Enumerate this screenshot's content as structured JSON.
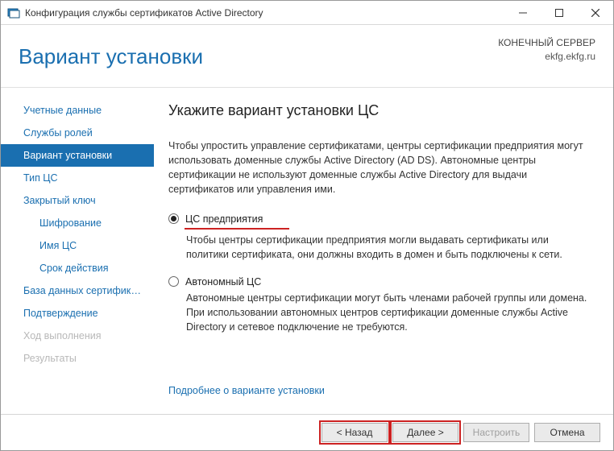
{
  "colors": {
    "accent": "#1a6fb0",
    "highlight": "#c22"
  },
  "titlebar": {
    "title": "Конфигурация службы сертификатов Active Directory"
  },
  "header": {
    "title": "Вариант установки",
    "meta_label": "КОНЕЧНЫЙ СЕРВЕР",
    "meta_value": "ekfg.ekfg.ru"
  },
  "sidebar": {
    "items": [
      {
        "label": "Учетные данные",
        "active": false,
        "disabled": false,
        "level": 1
      },
      {
        "label": "Службы ролей",
        "active": false,
        "disabled": false,
        "level": 1
      },
      {
        "label": "Вариант установки",
        "active": true,
        "disabled": false,
        "level": 1
      },
      {
        "label": "Тип ЦС",
        "active": false,
        "disabled": false,
        "level": 1
      },
      {
        "label": "Закрытый ключ",
        "active": false,
        "disabled": false,
        "level": 1
      },
      {
        "label": "Шифрование",
        "active": false,
        "disabled": false,
        "level": 2
      },
      {
        "label": "Имя ЦС",
        "active": false,
        "disabled": false,
        "level": 2
      },
      {
        "label": "Срок действия",
        "active": false,
        "disabled": false,
        "level": 2
      },
      {
        "label": "База данных сертификат...",
        "active": false,
        "disabled": false,
        "level": 1
      },
      {
        "label": "Подтверждение",
        "active": false,
        "disabled": false,
        "level": 1
      },
      {
        "label": "Ход выполнения",
        "active": false,
        "disabled": true,
        "level": 1
      },
      {
        "label": "Результаты",
        "active": false,
        "disabled": true,
        "level": 1
      }
    ]
  },
  "main": {
    "heading": "Укажите вариант установки ЦС",
    "intro": "Чтобы упростить управление сертификатами, центры сертификации предприятия могут использовать доменные службы Active Directory (AD DS). Автономные центры сертификации не используют доменные службы Active Directory для выдачи сертификатов или управления ими.",
    "options": [
      {
        "id": "enterprise-ca",
        "label": "ЦС предприятия",
        "checked": true,
        "underline": true,
        "desc": "Чтобы центры сертификации предприятия могли выдавать сертификаты или политики сертификата, они должны входить в домен и быть подключены к сети."
      },
      {
        "id": "standalone-ca",
        "label": "Автономный ЦС",
        "checked": false,
        "underline": false,
        "desc": "Автономные центры сертификации могут быть членами рабочей группы или домена. При использовании автономных центров сертификации доменные службы Active Directory и сетевое подключение не требуются."
      }
    ],
    "more_link": "Подробнее о варианте установки"
  },
  "footer": {
    "back": "< Назад",
    "next": "Далее >",
    "configure": "Настроить",
    "cancel": "Отмена"
  }
}
